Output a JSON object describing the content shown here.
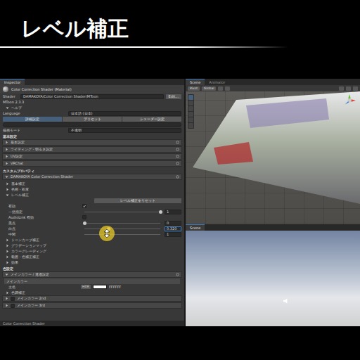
{
  "title": "レベル補正",
  "inspector": {
    "tab": "Inspector",
    "material": "Color Correction Shader (Material)",
    "shader_label": "Shader",
    "shader": "DAMAKOYA/Color Correction Shader/MToon",
    "edit_button": "Edit...",
    "rows": [
      {
        "kind": "text",
        "label": "MToon 2.3.3"
      },
      {
        "kind": "subfold",
        "label": "ヘルプ",
        "expanded": true
      },
      {
        "kind": "field",
        "label": "Language",
        "value": "日本語 (日本)"
      },
      {
        "kind": "tabs",
        "items": [
          {
            "label": "詳細設定",
            "selected": true
          },
          {
            "label": "プリセット",
            "selected": false
          },
          {
            "label": "シェーダー設定",
            "selected": false
          }
        ]
      },
      {
        "kind": "search"
      },
      {
        "kind": "field",
        "label": "描画モード",
        "value": "不透明"
      },
      {
        "kind": "section",
        "label": "基本設定"
      },
      {
        "kind": "fold",
        "label": "基本設定",
        "expanded": false
      },
      {
        "kind": "fold",
        "label": "ライティング・明るさ設定",
        "expanded": false
      },
      {
        "kind": "fold",
        "label": "UV設定",
        "expanded": false
      },
      {
        "kind": "fold",
        "label": "VRChat",
        "expanded": false
      },
      {
        "kind": "section",
        "label": "カスタムプロパティ"
      },
      {
        "kind": "fold",
        "label": "DAMAKOYA Color Correction Shader",
        "expanded": true
      },
      {
        "kind": "subfold",
        "label": "基本補正",
        "expanded": false
      },
      {
        "kind": "subfold",
        "label": "色相・彩度",
        "expanded": false
      },
      {
        "kind": "subfold",
        "label": "レベル補正",
        "expanded": true
      },
      {
        "kind": "button",
        "label": "レベル補正をリセット"
      },
      {
        "kind": "check",
        "label": "有効",
        "checked": true
      },
      {
        "kind": "slider",
        "label": "一括指定",
        "level": 1,
        "value": "1",
        "selected": false
      },
      {
        "kind": "check",
        "label": "AudioLink 有効",
        "checked": false
      },
      {
        "kind": "slider",
        "label": "黒点",
        "level": 0,
        "value": "0",
        "selected": false
      },
      {
        "kind": "slider",
        "label": "白点",
        "level": 0.32,
        "value": "0.320",
        "selected": true
      },
      {
        "kind": "slider",
        "label": "中間",
        "level": 0.3,
        "value": "1",
        "selected": false
      },
      {
        "kind": "subfold",
        "label": "トーンカーブ補正",
        "expanded": false
      },
      {
        "kind": "subfold",
        "label": "グラデーションマップ",
        "expanded": false
      },
      {
        "kind": "subfold",
        "label": "カラーグレーディング",
        "expanded": false
      },
      {
        "kind": "subfold",
        "label": "範囲・色補正補正",
        "expanded": false
      },
      {
        "kind": "subfold",
        "label": "効果",
        "expanded": false
      },
      {
        "kind": "section",
        "label": "色設定"
      },
      {
        "kind": "fold",
        "label": "メインカラー / 透過設定",
        "expanded": true
      },
      {
        "kind": "subhead",
        "label": "メインカラー"
      },
      {
        "kind": "color",
        "label": "主色",
        "badge": "HDR",
        "value": "FFFFFF"
      },
      {
        "kind": "subfold",
        "label": "色調補正",
        "expanded": false
      },
      {
        "kind": "checkfold",
        "label": "メインカラー 2nd",
        "checked": false
      },
      {
        "kind": "checkfold",
        "label": "メインカラー 3rd",
        "checked": false
      }
    ],
    "footer": "Color Correction Shader"
  },
  "scene": {
    "tabs": [
      {
        "label": "Scene",
        "selected": true
      },
      {
        "label": "Animator",
        "selected": false
      }
    ],
    "toolbar": [
      "Pivot",
      "Global"
    ],
    "bottom_tab": "Scene"
  }
}
